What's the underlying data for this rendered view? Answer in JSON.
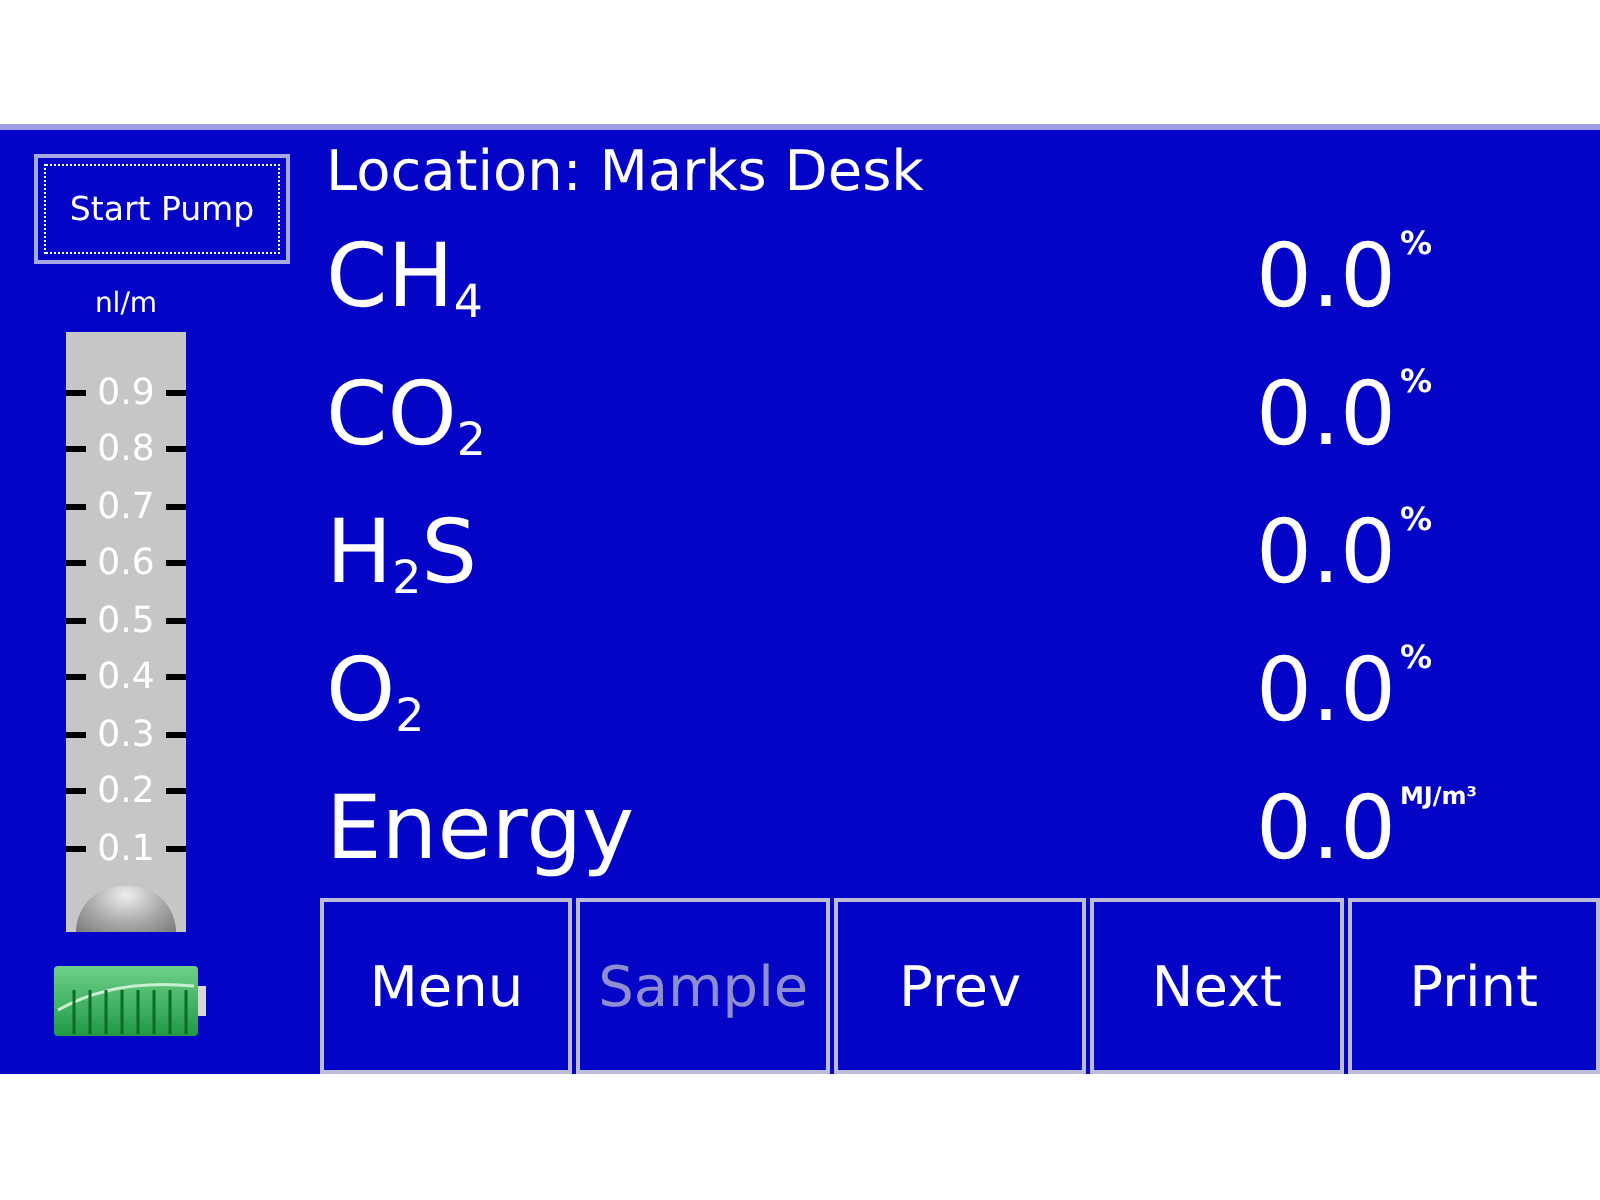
{
  "start_pump_button": {
    "label": "Start Pump",
    "focused": true
  },
  "flow_gauge": {
    "unit": "nl/m",
    "ticks": [
      "0.9",
      "0.8",
      "0.7",
      "0.6",
      "0.5",
      "0.4",
      "0.3",
      "0.2",
      "0.1"
    ],
    "level": 0
  },
  "location": "Location: Marks Desk",
  "readings": [
    {
      "gas": "CH$_{4}$",
      "value": "0.0",
      "unit": "%"
    },
    {
      "gas": "CO$_{2}$",
      "value": "0.0",
      "unit": "%"
    },
    {
      "gas": "H$_{2}$S",
      "value": "0.0",
      "unit": "%"
    },
    {
      "gas": "O$_{2}$",
      "value": "0.0",
      "unit": "%"
    },
    {
      "gas": "Energy",
      "value": "0.0",
      "unit": "MJ/m³"
    }
  ],
  "buttons": [
    {
      "label": "Menu",
      "disabled": false
    },
    {
      "label": "Sample",
      "disabled": true
    },
    {
      "label": "Prev",
      "disabled": false
    },
    {
      "label": "Next",
      "disabled": false
    },
    {
      "label": "Print",
      "disabled": false
    }
  ]
}
